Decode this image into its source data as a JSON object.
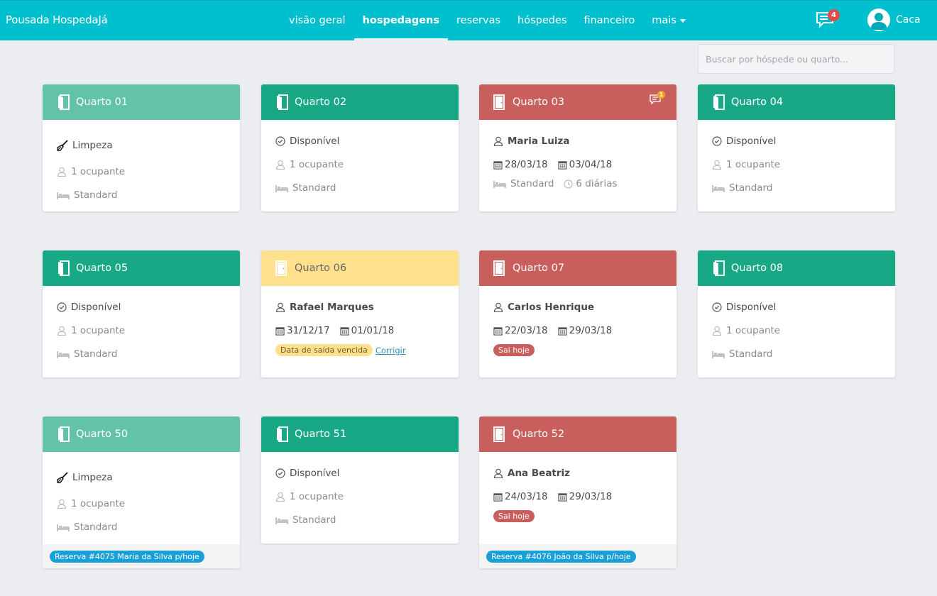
{
  "app": {
    "brand": "Pousada HospedaJá"
  },
  "nav": {
    "items": [
      "visão geral",
      "hospedagens",
      "reservas",
      "hóspedes",
      "financeiro",
      "mais"
    ],
    "active": "hospedagens"
  },
  "header": {
    "messages_count": "4",
    "user_name": "Caca"
  },
  "search": {
    "placeholder": "Buscar por hóspede ou quarto..."
  },
  "colors": {
    "topbar": "#00c0cf",
    "cleaning": "#62c3a9",
    "available": "#19a886",
    "occupied": "#c85f5c",
    "overdue": "#ffe08d",
    "reservation": "#1aa0d8"
  },
  "rooms": [
    {
      "name": "Quarto 01",
      "status": "Limpeza",
      "occupants": "1 ocupante",
      "type": "Standard"
    },
    {
      "name": "Quarto 02",
      "status": "Disponível",
      "occupants": "1 ocupante",
      "type": "Standard"
    },
    {
      "name": "Quarto 03",
      "guest": "Maria Luiza",
      "checkin": "28/03/18",
      "checkout": "03/04/18",
      "type": "Standard",
      "nights": "6 diárias",
      "messages": "1"
    },
    {
      "name": "Quarto 04",
      "status": "Disponível",
      "occupants": "1 ocupante",
      "type": "Standard"
    },
    {
      "name": "Quarto 05",
      "status": "Disponível",
      "occupants": "1 ocupante",
      "type": "Standard"
    },
    {
      "name": "Quarto 06",
      "guest": "Rafael Marques",
      "checkin": "31/12/17",
      "checkout": "01/01/18",
      "badge": "Data de saída vencida",
      "link": "Corrigir"
    },
    {
      "name": "Quarto 07",
      "guest": "Carlos Henrique",
      "checkin": "22/03/18",
      "checkout": "29/03/18",
      "badge": "Sai hoje"
    },
    {
      "name": "Quarto 08",
      "status": "Disponível",
      "occupants": "1 ocupante",
      "type": "Standard"
    },
    {
      "name": "Quarto 50",
      "status": "Limpeza",
      "occupants": "1 ocupante",
      "type": "Standard",
      "reservation": "Reserva #4075 Maria da Silva p/hoje"
    },
    {
      "name": "Quarto 51",
      "status": "Disponível",
      "occupants": "1 ocupante",
      "type": "Standard"
    },
    {
      "name": "Quarto 52",
      "guest": "Ana Beatriz",
      "checkin": "24/03/18",
      "checkout": "29/03/18",
      "badge": "Sai hoje",
      "reservation": "Reserva #4076 João da Silva p/hoje"
    }
  ]
}
